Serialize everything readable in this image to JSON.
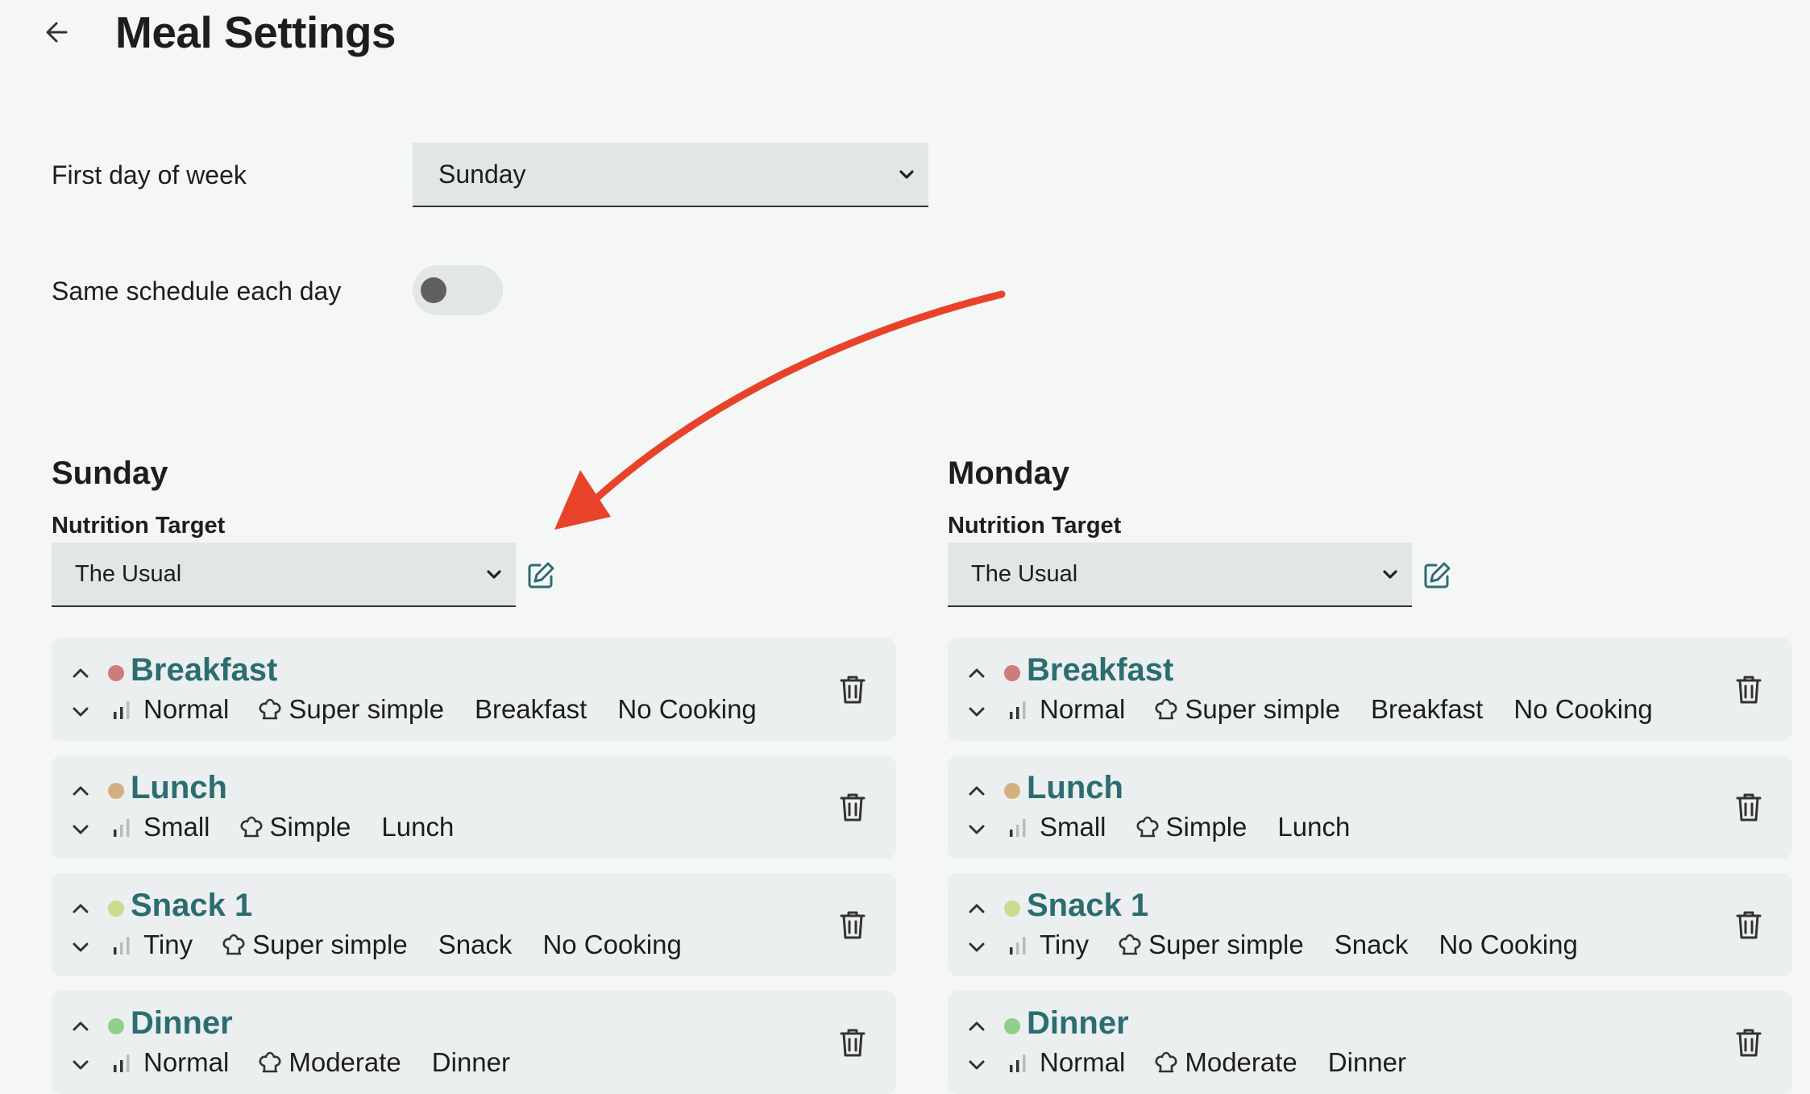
{
  "header": {
    "title": "Meal Settings"
  },
  "settings": {
    "first_day_label": "First day of week",
    "first_day_value": "Sunday",
    "same_schedule_label": "Same schedule each day",
    "same_schedule_on": false
  },
  "colors": {
    "accent": "#2b6d70",
    "arrow": "#e8432a",
    "dot_breakfast": "#cf7b7b",
    "dot_lunch": "#d4b07e",
    "dot_snack": "#c9dd8f",
    "dot_dinner": "#8fd08a"
  },
  "days": [
    {
      "name": "Sunday",
      "nutrition_label": "Nutrition Target",
      "nutrition_value": "The Usual",
      "meals": [
        {
          "name": "Breakfast",
          "size": "Normal",
          "effort": "Super simple",
          "kind": "Breakfast",
          "cooking": "No Cooking"
        },
        {
          "name": "Lunch",
          "size": "Small",
          "effort": "Simple",
          "kind": "Lunch",
          "cooking": ""
        },
        {
          "name": "Snack 1",
          "size": "Tiny",
          "effort": "Super simple",
          "kind": "Snack",
          "cooking": "No Cooking"
        },
        {
          "name": "Dinner",
          "size": "Normal",
          "effort": "Moderate",
          "kind": "Dinner",
          "cooking": ""
        }
      ]
    },
    {
      "name": "Monday",
      "nutrition_label": "Nutrition Target",
      "nutrition_value": "The Usual",
      "meals": [
        {
          "name": "Breakfast",
          "size": "Normal",
          "effort": "Super simple",
          "kind": "Breakfast",
          "cooking": "No Cooking"
        },
        {
          "name": "Lunch",
          "size": "Small",
          "effort": "Simple",
          "kind": "Lunch",
          "cooking": ""
        },
        {
          "name": "Snack 1",
          "size": "Tiny",
          "effort": "Super simple",
          "kind": "Snack",
          "cooking": "No Cooking"
        },
        {
          "name": "Dinner",
          "size": "Normal",
          "effort": "Moderate",
          "kind": "Dinner",
          "cooking": ""
        }
      ]
    }
  ]
}
